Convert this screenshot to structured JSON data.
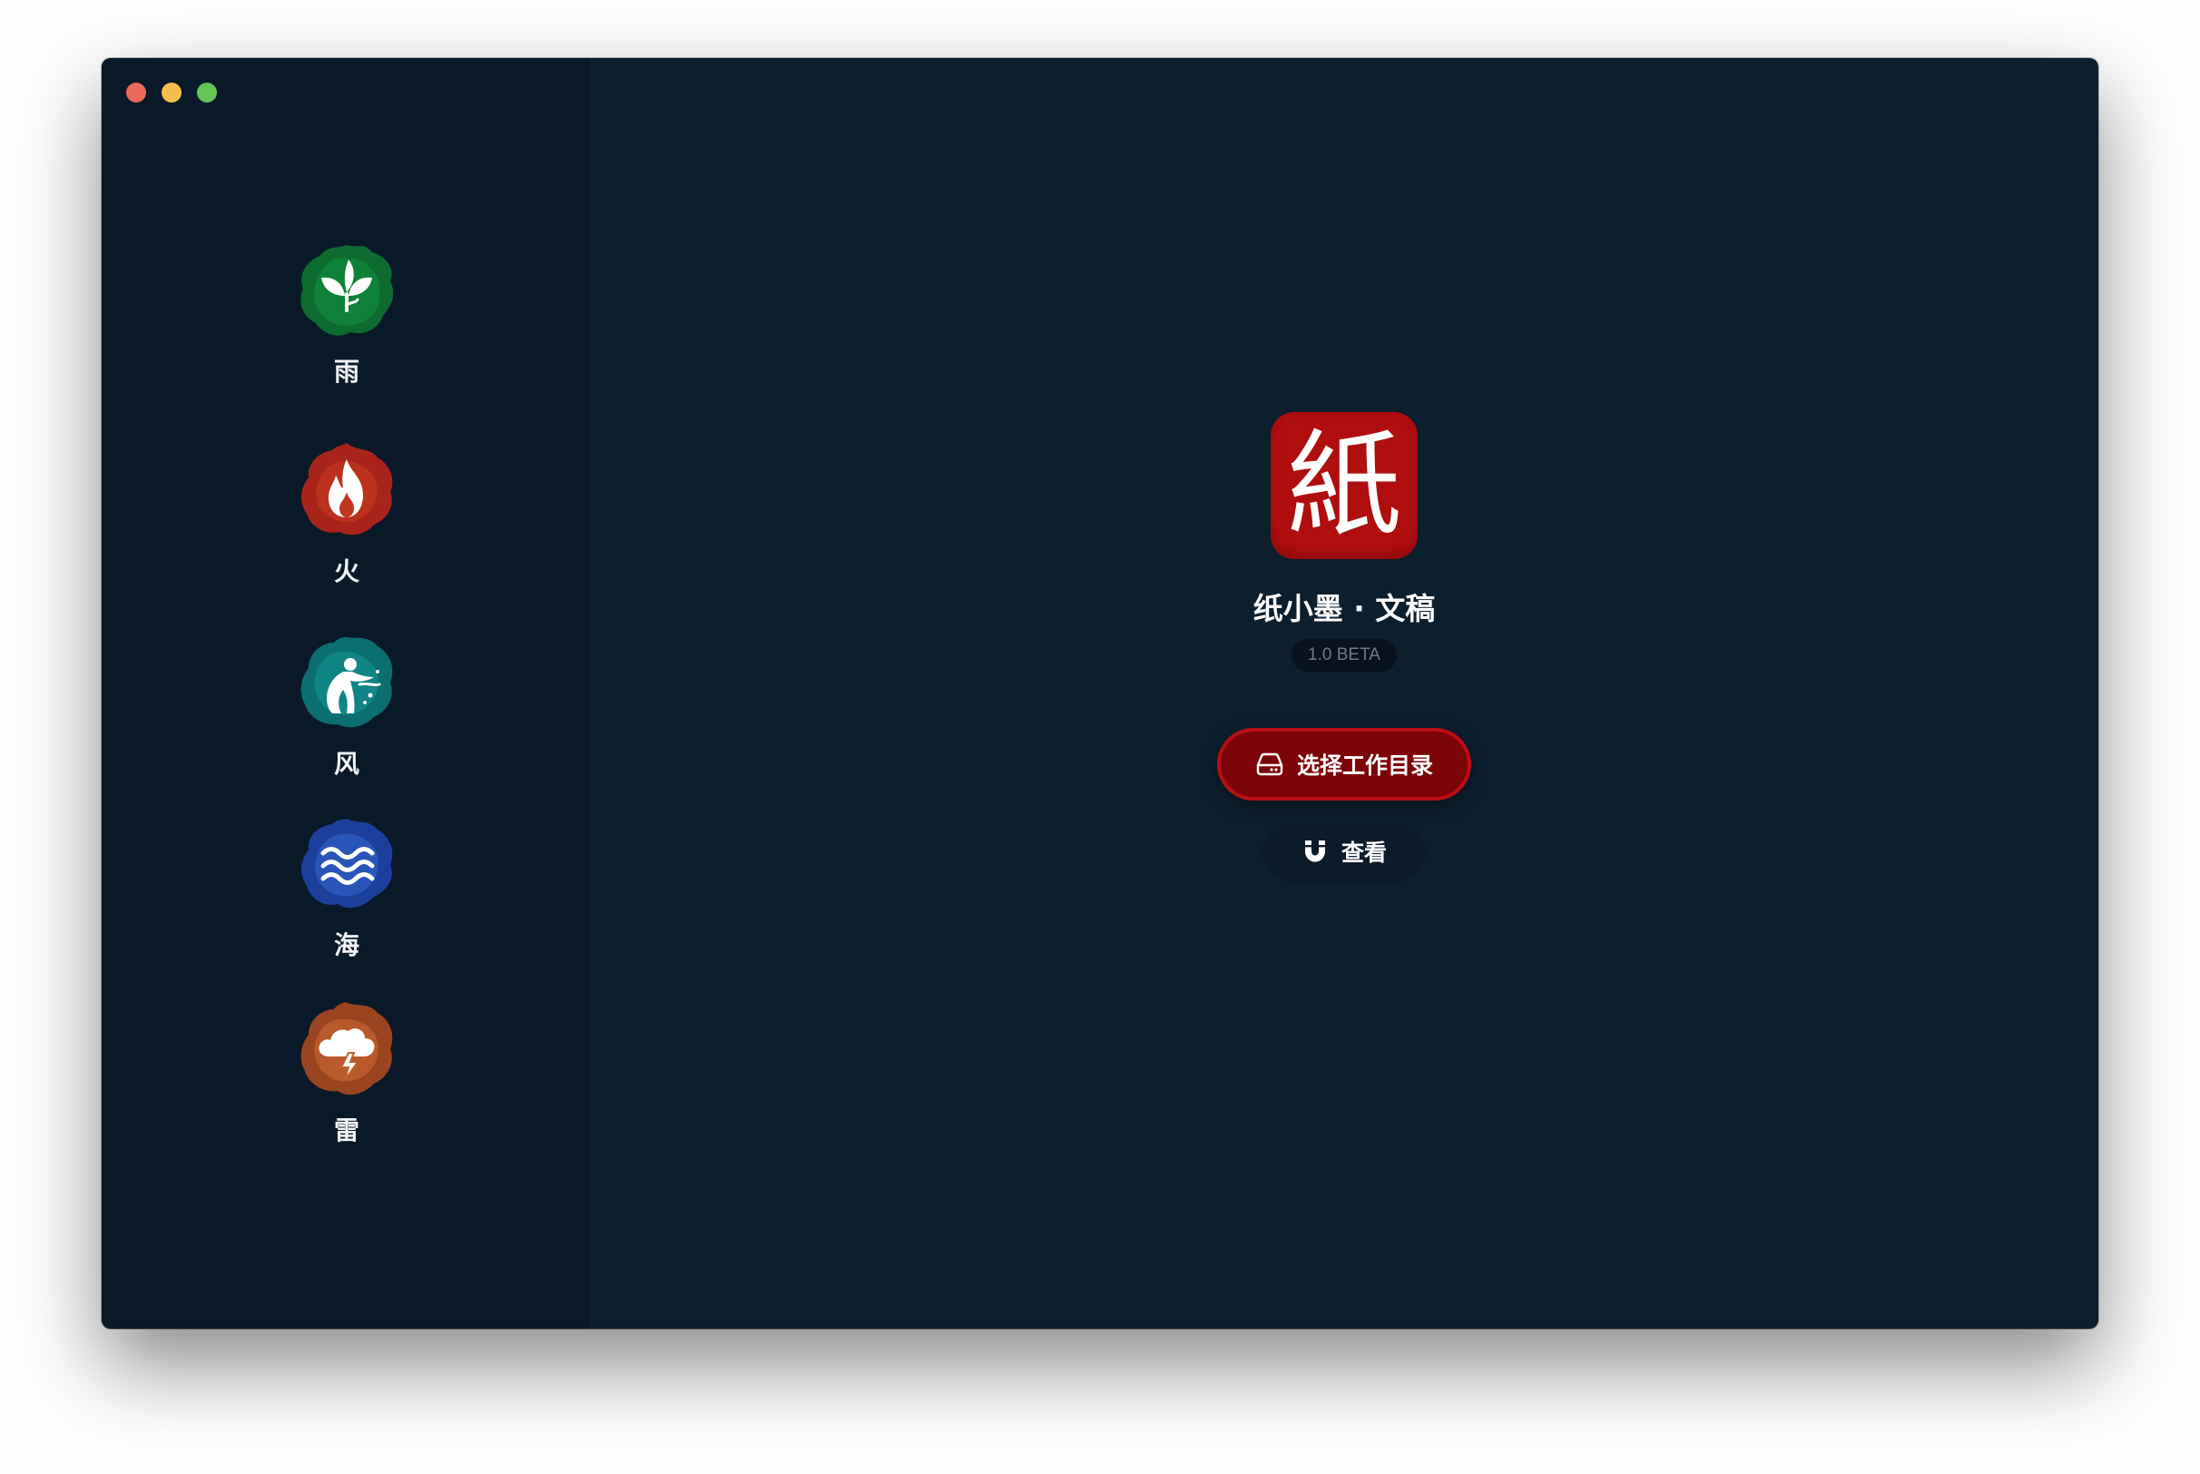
{
  "window": {
    "controls": [
      "close",
      "minimize",
      "zoom"
    ]
  },
  "sidebar": {
    "items": [
      {
        "label": "雨",
        "icon": "leaf-icon",
        "color": "#0e7a36"
      },
      {
        "label": "火",
        "icon": "flame-icon",
        "color": "#b7301c"
      },
      {
        "label": "风",
        "icon": "wind-figure-icon",
        "color": "#0f8a8c"
      },
      {
        "label": "海",
        "icon": "waves-icon",
        "color": "#2152b6"
      },
      {
        "label": "雷",
        "icon": "thunder-cloud-icon",
        "color": "#c0542a"
      }
    ]
  },
  "app": {
    "logo_char": "紙",
    "name": "纸小墨 · 文稿",
    "version": "1.0 BETA"
  },
  "actions": {
    "primary_label": "选择工作目录",
    "secondary_label": "查看"
  },
  "colors": {
    "accent": "#b00d0f",
    "sidebar_bg": "#0a1928",
    "main_bg": "#0d1e2d"
  }
}
